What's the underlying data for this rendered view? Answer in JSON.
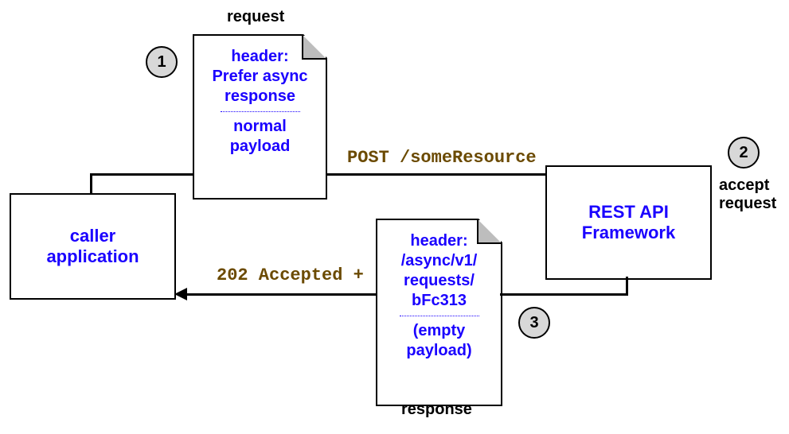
{
  "labels": {
    "request": "request",
    "response": "response",
    "accept_request_1": "accept",
    "accept_request_2": "request"
  },
  "badges": {
    "b1": "1",
    "b2": "2",
    "b3": "3"
  },
  "caller": {
    "line1": "caller",
    "line2": "application"
  },
  "restapi": {
    "line1": "REST API",
    "line2": "Framework"
  },
  "request_doc": {
    "h1": "header:",
    "h2": "Prefer async",
    "h3": "response",
    "p1": "normal",
    "p2": "payload"
  },
  "response_doc": {
    "h1": "header:",
    "h2": "/async/v1/",
    "h3": "requests/",
    "h4": "bFc313",
    "p1": "(empty",
    "p2": "payload)"
  },
  "mono": {
    "post": "POST /someResource",
    "accepted": "202 Accepted +"
  }
}
